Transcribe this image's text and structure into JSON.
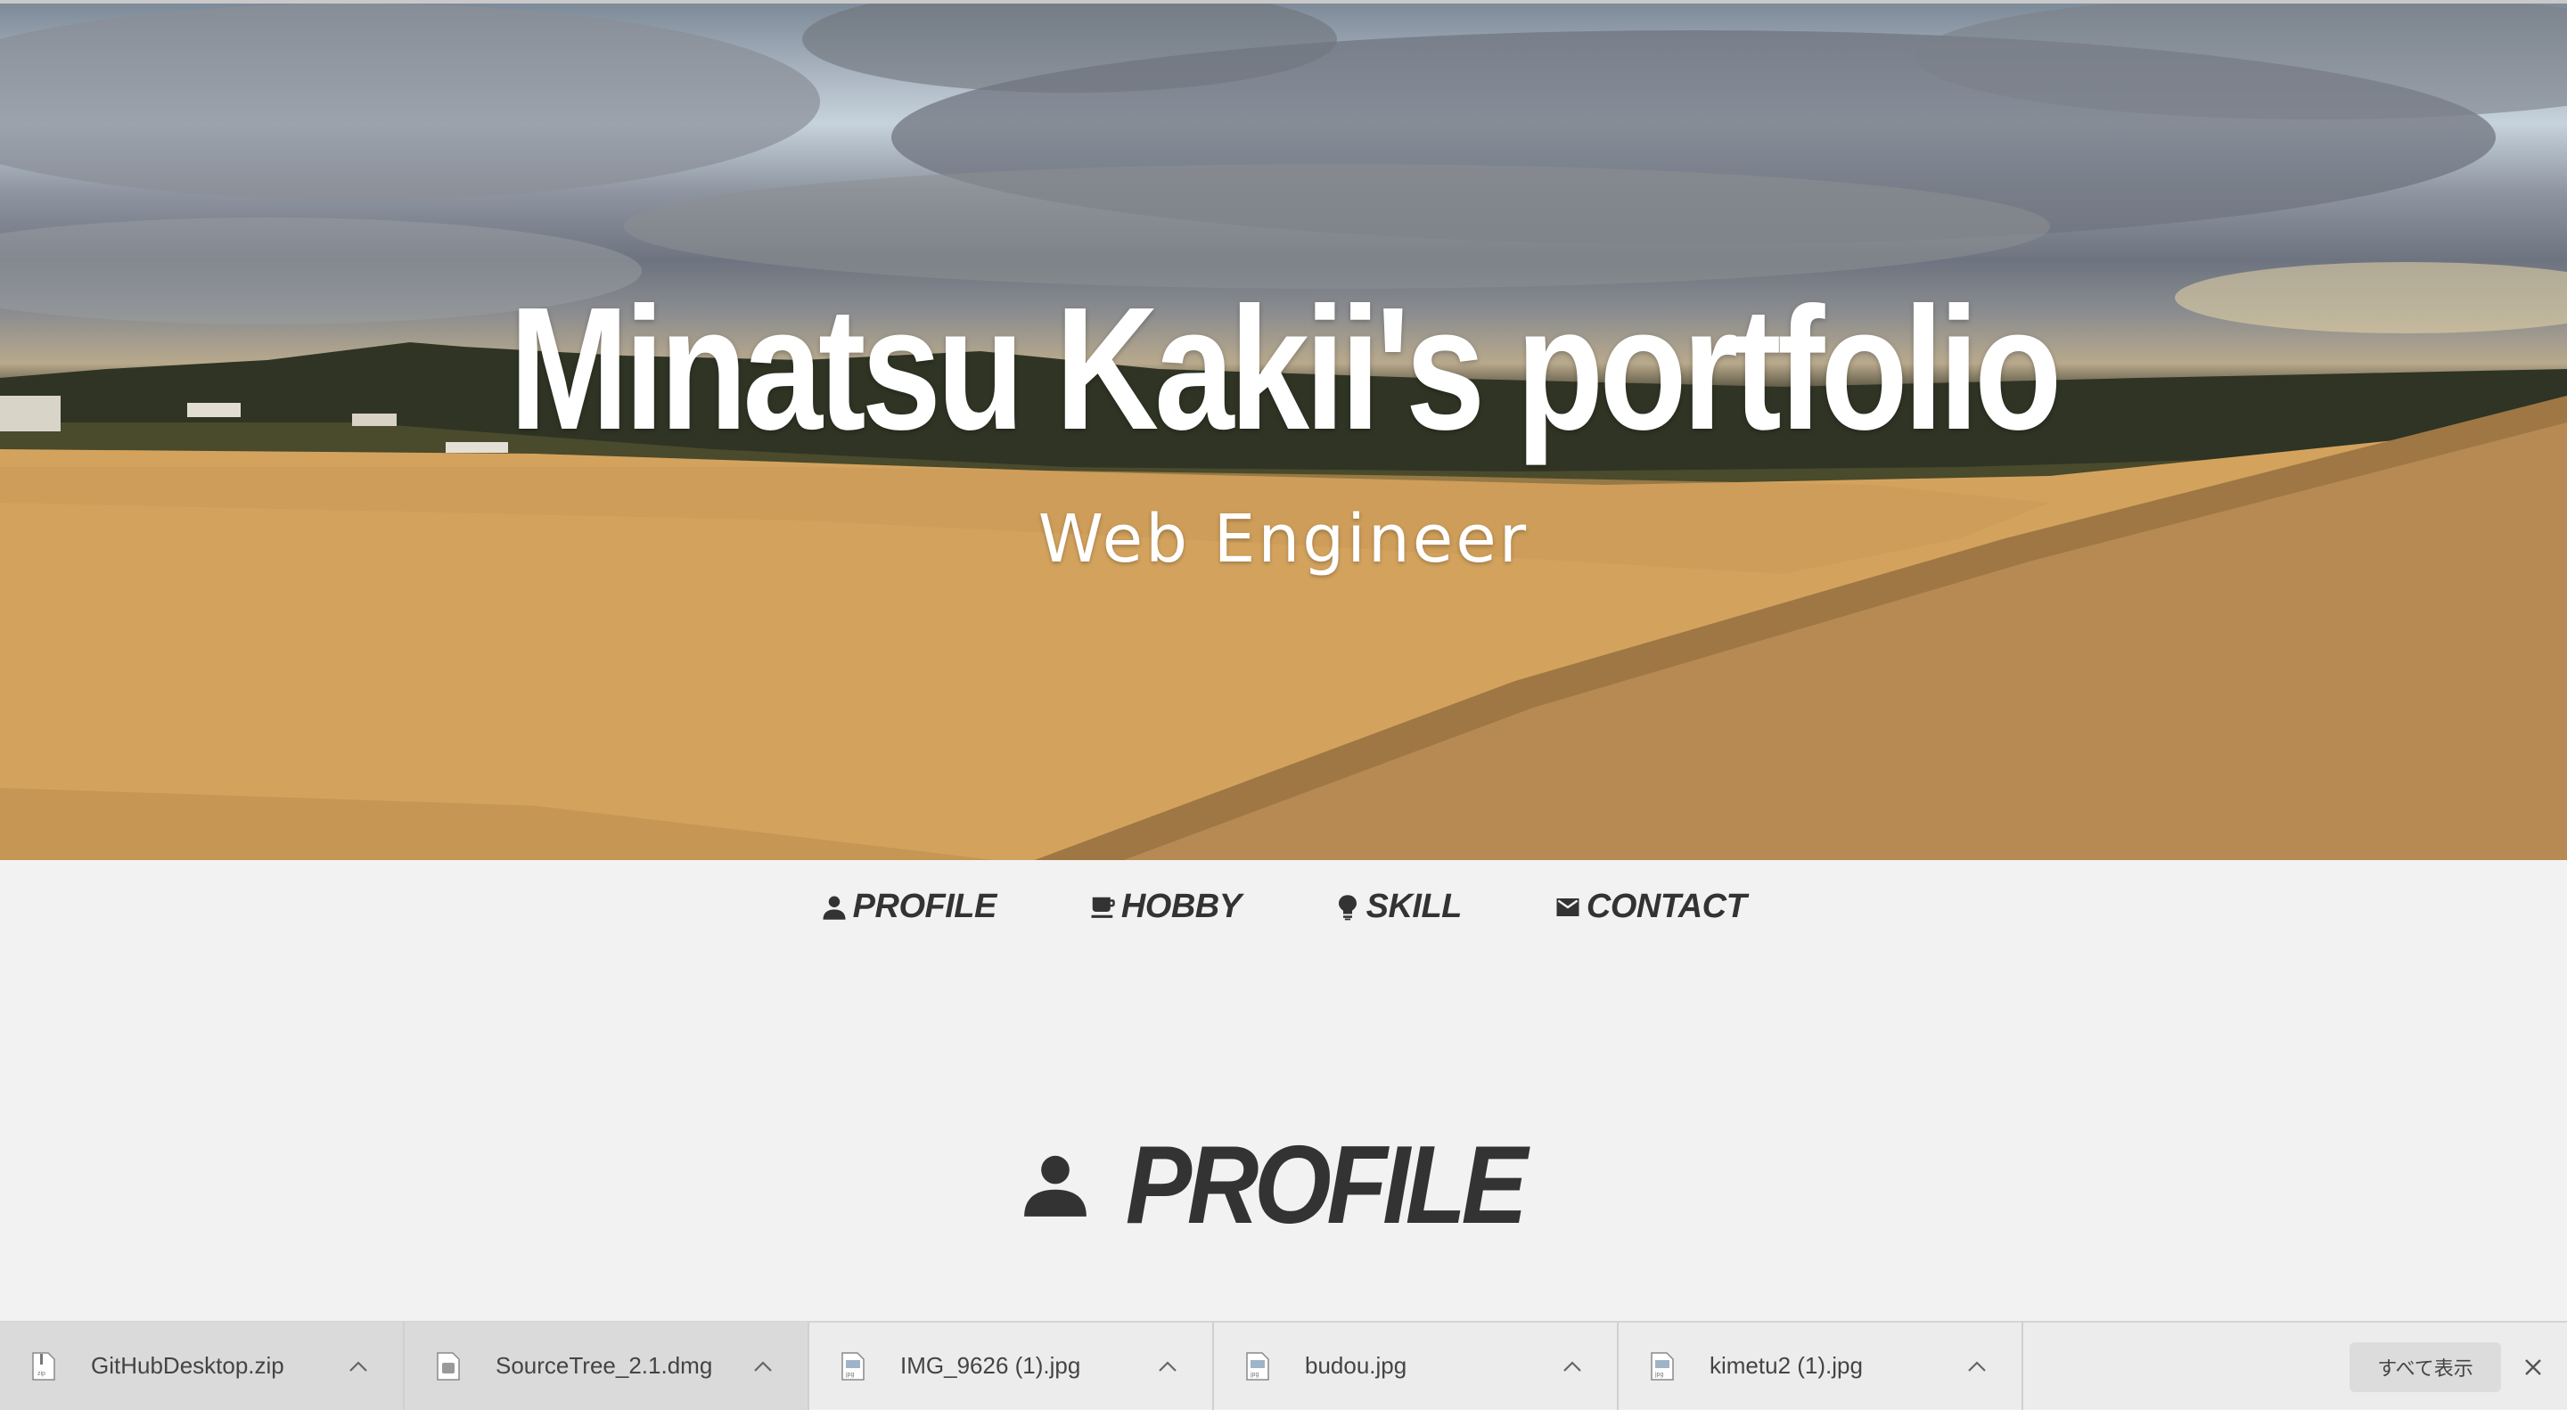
{
  "hero": {
    "title": "Minatsu Kakii's portfolio",
    "subtitle": "Web Engineer"
  },
  "nav": {
    "items": [
      {
        "label": "PROFILE",
        "icon": "person-icon"
      },
      {
        "label": "HOBBY",
        "icon": "coffee-icon"
      },
      {
        "label": "SKILL",
        "icon": "lightbulb-icon"
      },
      {
        "label": "CONTACT",
        "icon": "mail-icon"
      }
    ]
  },
  "section": {
    "heading": "PROFILE",
    "icon": "person-icon"
  },
  "downloads": {
    "items": [
      {
        "name": "GitHubDesktop.zip",
        "icon": "zip-file-icon"
      },
      {
        "name": "SourceTree_2.1.dmg",
        "icon": "dmg-file-icon"
      },
      {
        "name": "IMG_9626 (1).jpg",
        "icon": "jpg-file-icon"
      },
      {
        "name": "budou.jpg",
        "icon": "jpg-file-icon"
      },
      {
        "name": "kimetu2 (1).jpg",
        "icon": "jpg-file-icon"
      }
    ],
    "show_all": "すべて表示"
  },
  "colors": {
    "text_dark": "#333333",
    "page_bg": "#f2f2f2",
    "shelf_bg": "#ececec"
  }
}
